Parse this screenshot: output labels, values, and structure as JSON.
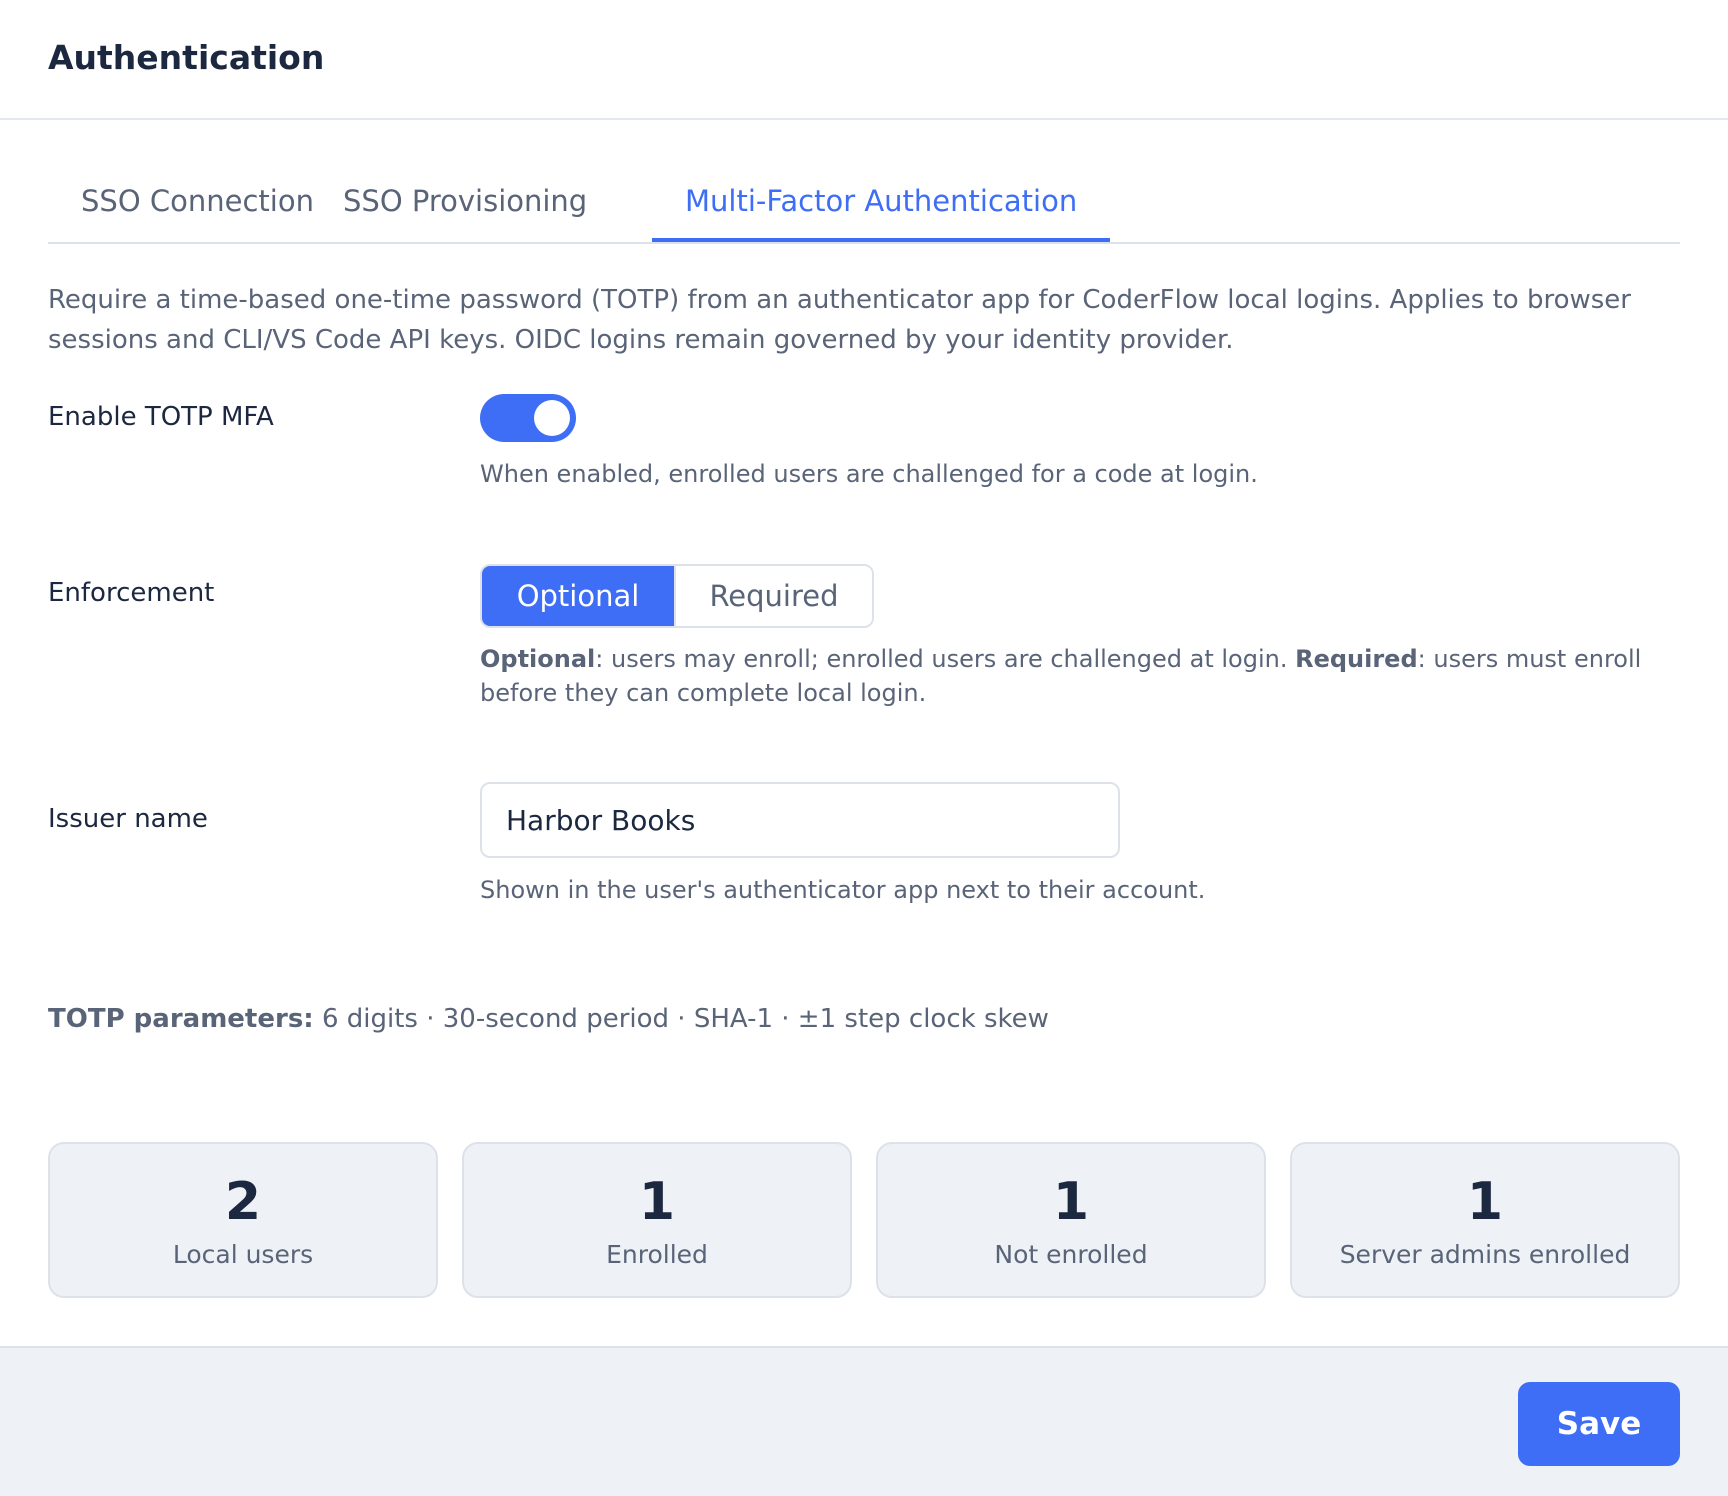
{
  "header": {
    "title": "Authentication"
  },
  "tabs": [
    {
      "label": "SSO Connection",
      "active": false
    },
    {
      "label": "SSO Provisioning",
      "active": false
    },
    {
      "label": "Multi-Factor Authentication",
      "active": true
    }
  ],
  "description": "Require a time-based one-time password (TOTP) from an authenticator app for CoderFlow local logins. Applies to browser sessions and CLI/VS Code API keys. OIDC logins remain governed by your identity provider.",
  "mfa_toggle": {
    "label": "Enable TOTP MFA",
    "enabled": true,
    "help": "When enabled, enrolled users are challenged for a code at login."
  },
  "enforcement": {
    "label": "Enforcement",
    "options": [
      "Optional",
      "Required"
    ],
    "selected": "Optional",
    "help_optional_term": "Optional",
    "help_optional_text": ": users may enroll; enrolled users are challenged at login. ",
    "help_required_term": "Required",
    "help_required_text": ": users must enroll before they can complete local login."
  },
  "issuer": {
    "label": "Issuer name",
    "value": "Harbor Books",
    "help": "Shown in the user's authenticator app next to their account."
  },
  "totp_params": {
    "label": "TOTP parameters:",
    "text": " 6 digits · 30-second period · SHA-1 · ±1 step clock skew"
  },
  "stats": [
    {
      "value": "2",
      "label": "Local users"
    },
    {
      "value": "1",
      "label": "Enrolled"
    },
    {
      "value": "1",
      "label": "Not enrolled"
    },
    {
      "value": "1",
      "label": "Server admins enrolled"
    }
  ],
  "footer": {
    "save_label": "Save"
  },
  "colors": {
    "accent": "#3d6ef5",
    "text_primary": "#1c2740",
    "text_secondary": "#5a6478",
    "border": "#dde2ea",
    "panel_bg": "#eef1f6"
  }
}
